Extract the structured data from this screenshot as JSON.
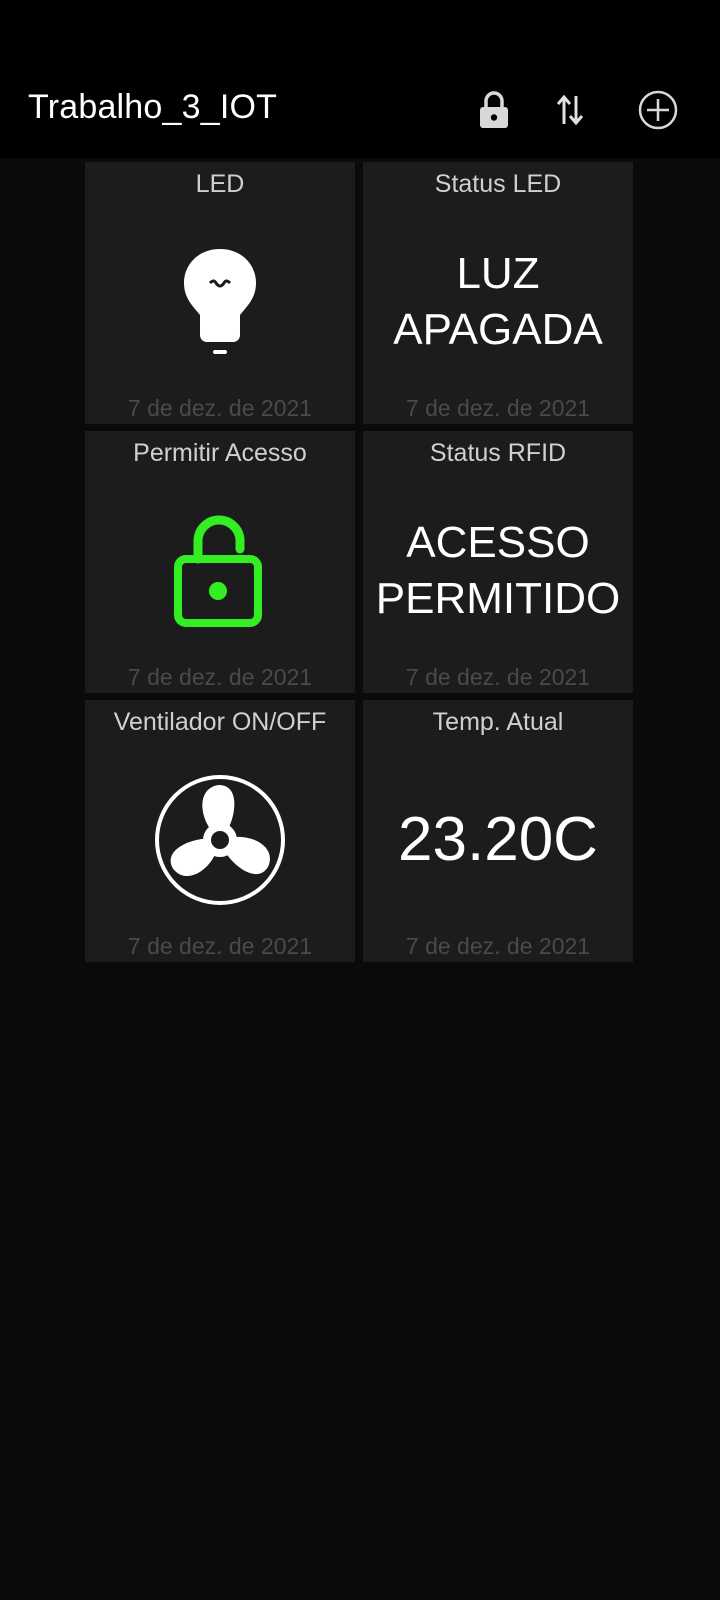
{
  "app_bar": {
    "title": "Trabalho_3_IOT",
    "icons": [
      "lock-icon",
      "swap-vertical-icon",
      "add-circle-icon"
    ]
  },
  "tiles": [
    {
      "title": "LED",
      "icon": "lightbulb-icon",
      "date": "7 de dez. de 2021"
    },
    {
      "title": "Status LED",
      "value_line1": "LUZ",
      "value_line2": "APAGADA",
      "date": "7 de dez. de 2021"
    },
    {
      "title": "Permitir Acesso",
      "icon": "unlock-icon",
      "icon_color": "#33ee22",
      "date": "7 de dez. de 2021"
    },
    {
      "title": "Status RFID",
      "value_line1": "ACESSO",
      "value_line2": "PERMITIDO",
      "date": "7 de dez. de 2021"
    },
    {
      "title": "Ventilador ON/OFF",
      "icon": "fan-icon",
      "date": "7 de dez. de 2021"
    },
    {
      "title": "Temp. Atual",
      "value_line1": "23.20C",
      "date": "7 de dez. de 2021"
    }
  ],
  "colors": {
    "background": "#0a0a0a",
    "app_bar": "#000000",
    "tile": "#1c1c1c",
    "accent_green": "#33ee22",
    "date_text": "#4a4a4a"
  }
}
